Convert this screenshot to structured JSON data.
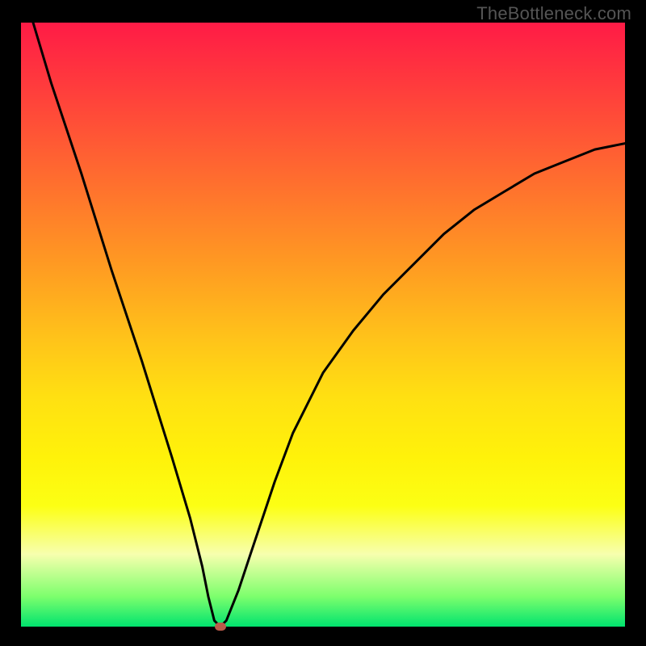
{
  "watermark": "TheBottleneck.com",
  "colors": {
    "frame": "#000000",
    "gradient_top": "#ff1b46",
    "gradient_bottom": "#00e36e",
    "curve": "#000000",
    "marker": "#bb5a4a",
    "watermark": "#555555"
  },
  "chart_data": {
    "type": "line",
    "title": "",
    "xlabel": "",
    "ylabel": "",
    "xlim": [
      0,
      100
    ],
    "ylim": [
      0,
      100
    ],
    "grid": false,
    "series": [
      {
        "name": "curve",
        "x": [
          2,
          5,
          10,
          15,
          20,
          25,
          28,
          30,
          31,
          32,
          33,
          34,
          36,
          38,
          40,
          42,
          45,
          50,
          55,
          60,
          65,
          70,
          75,
          80,
          85,
          90,
          95,
          100
        ],
        "values": [
          100,
          90,
          75,
          59,
          44,
          28,
          18,
          10,
          5,
          1,
          0,
          1,
          6,
          12,
          18,
          24,
          32,
          42,
          49,
          55,
          60,
          65,
          69,
          72,
          75,
          77,
          79,
          80
        ]
      }
    ],
    "marker": {
      "x": 33,
      "y": 0
    },
    "annotations": []
  }
}
